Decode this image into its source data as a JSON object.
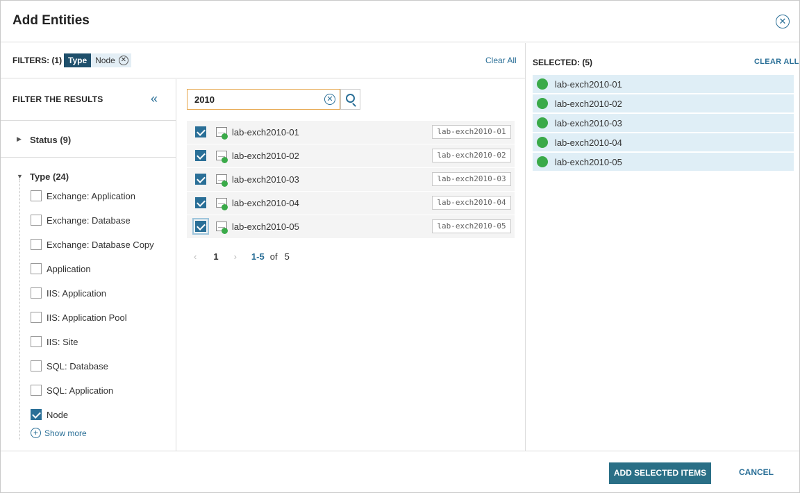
{
  "dialog": {
    "title": "Add Entities"
  },
  "filters_bar": {
    "label": "FILTERS: (1)",
    "chip": {
      "key": "Type",
      "value": "Node"
    },
    "clear_all": "Clear All"
  },
  "sidebar": {
    "heading": "FILTER THE RESULTS",
    "groups": [
      {
        "label": "Status (9)",
        "expanded": false
      },
      {
        "label": "Type (24)",
        "expanded": true
      }
    ],
    "type_items": [
      {
        "label": "Exchange: Application",
        "checked": false
      },
      {
        "label": "Exchange: Database",
        "checked": false
      },
      {
        "label": "Exchange: Database Copy",
        "checked": false
      },
      {
        "label": "Application",
        "checked": false
      },
      {
        "label": "IIS: Application",
        "checked": false
      },
      {
        "label": "IIS: Application Pool",
        "checked": false
      },
      {
        "label": "IIS: Site",
        "checked": false
      },
      {
        "label": "SQL: Database",
        "checked": false
      },
      {
        "label": "SQL: Application",
        "checked": false
      },
      {
        "label": "Node",
        "checked": true
      }
    ],
    "show_more": "Show more"
  },
  "search": {
    "value": "2010"
  },
  "results": [
    {
      "name": "lab-exch2010-01",
      "tag": "lab-exch2010-01",
      "checked": true
    },
    {
      "name": "lab-exch2010-02",
      "tag": "lab-exch2010-02",
      "checked": true
    },
    {
      "name": "lab-exch2010-03",
      "tag": "lab-exch2010-03",
      "checked": true
    },
    {
      "name": "lab-exch2010-04",
      "tag": "lab-exch2010-04",
      "checked": true
    },
    {
      "name": "lab-exch2010-05",
      "tag": "lab-exch2010-05",
      "checked": true
    }
  ],
  "pagination": {
    "prev": "‹",
    "current": "1",
    "next": "›",
    "range": "1-5",
    "of": "of",
    "total": "5"
  },
  "selected": {
    "label": "SELECTED: (5)",
    "clear_all": "CLEAR ALL",
    "items": [
      "lab-exch2010-01",
      "lab-exch2010-02",
      "lab-exch2010-03",
      "lab-exch2010-04",
      "lab-exch2010-05"
    ]
  },
  "footer": {
    "primary": "ADD SELECTED ITEMS",
    "cancel": "CANCEL"
  },
  "colors": {
    "accent": "#2a6f97",
    "chip_dark": "#1e4f6b",
    "status_up": "#3aaa49",
    "selected_bg": "#dfeef6",
    "search_focus": "#e6a54a"
  },
  "icons": {
    "close": "close-circle-icon",
    "chip_remove": "remove-circle-icon",
    "collapse": "double-chevron-left-icon",
    "expand": "caret-icon",
    "show_more": "plus-circle-icon",
    "search": "search-icon",
    "clear_search": "clear-circle-icon",
    "node": "node-server-icon",
    "status": "status-up-icon"
  }
}
